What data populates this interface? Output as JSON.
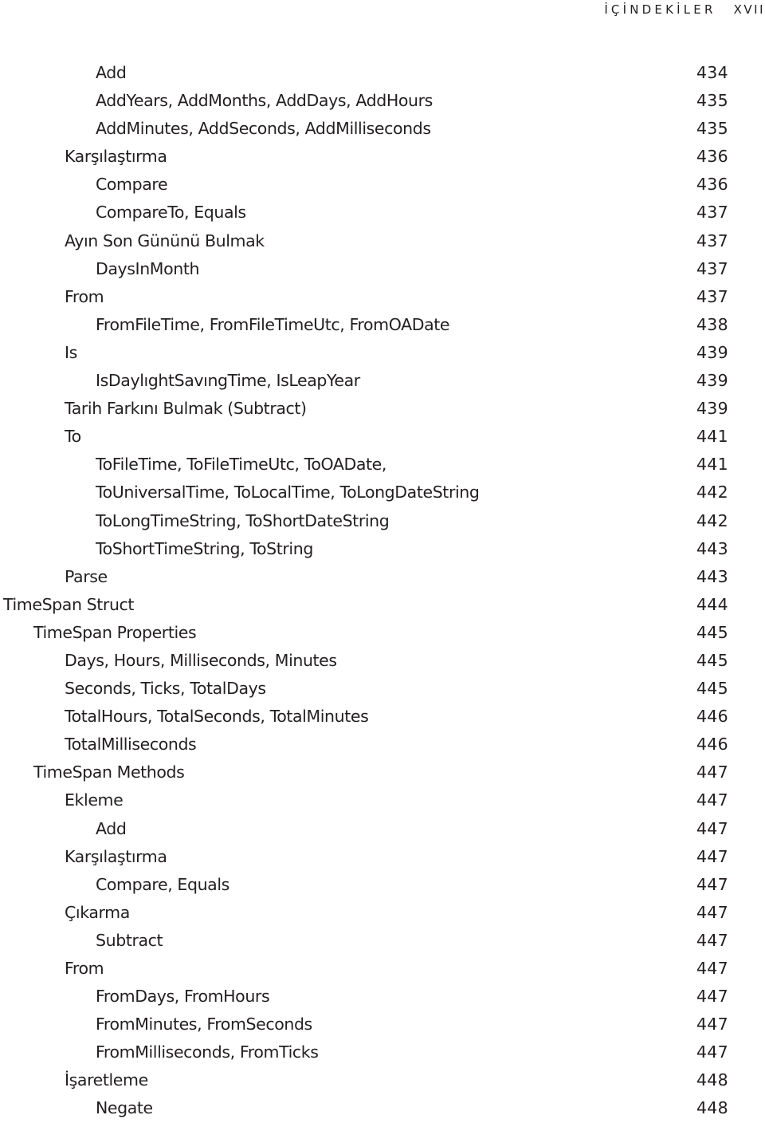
{
  "header": {
    "title": "İÇİNDEKİLER",
    "folio": "XVII"
  },
  "toc": {
    "entries": [
      {
        "title": "Add",
        "page": "434",
        "level": 3
      },
      {
        "title": "AddYears, AddMonths, AddDays, AddHours",
        "page": "435",
        "level": 3
      },
      {
        "title": "AddMinutes, AddSeconds, AddMilliseconds",
        "page": "435",
        "level": 3
      },
      {
        "title": "Karşılaştırma",
        "page": "436",
        "level": 2
      },
      {
        "title": "Compare",
        "page": "436",
        "level": 3
      },
      {
        "title": "CompareTo, Equals",
        "page": "437",
        "level": 3
      },
      {
        "title": "Ayın Son Gününü Bulmak",
        "page": "437",
        "level": 2
      },
      {
        "title": "DaysInMonth",
        "page": "437",
        "level": 3
      },
      {
        "title": "From",
        "page": "437",
        "level": 2
      },
      {
        "title": "FromFileTime, FromFileTimeUtc, FromOADate",
        "page": "438",
        "level": 3
      },
      {
        "title": "Is",
        "page": "439",
        "level": 2
      },
      {
        "title": "IsDaylıghtSavıngTime, IsLeapYear",
        "page": "439",
        "level": 3
      },
      {
        "title": "Tarih Farkını Bulmak (Subtract)",
        "page": "439",
        "level": 2
      },
      {
        "title": "To",
        "page": "441",
        "level": 2
      },
      {
        "title": "ToFileTime, ToFileTimeUtc, ToOADate,",
        "page": "441",
        "level": 3
      },
      {
        "title": "ToUniversalTime, ToLocalTime, ToLongDateString",
        "page": "442",
        "level": 3
      },
      {
        "title": "ToLongTimeString, ToShortDateString",
        "page": "442",
        "level": 3
      },
      {
        "title": "ToShortTimeString, ToString",
        "page": "443",
        "level": 3
      },
      {
        "title": "Parse",
        "page": "443",
        "level": 2
      },
      {
        "title": "TimeSpan Struct",
        "page": "444",
        "level": 0
      },
      {
        "title": "TimeSpan Properties",
        "page": "445",
        "level": 1
      },
      {
        "title": "Days, Hours, Milliseconds, Minutes",
        "page": "445",
        "level": 2
      },
      {
        "title": "Seconds, Ticks, TotalDays",
        "page": "445",
        "level": 2
      },
      {
        "title": "TotalHours, TotalSeconds, TotalMinutes",
        "page": "446",
        "level": 2
      },
      {
        "title": "TotalMilliseconds",
        "page": "446",
        "level": 2
      },
      {
        "title": "TimeSpan Methods",
        "page": "447",
        "level": 1
      },
      {
        "title": "Ekleme",
        "page": "447",
        "level": 2
      },
      {
        "title": "Add",
        "page": "447",
        "level": 3
      },
      {
        "title": "Karşılaştırma",
        "page": "447",
        "level": 2
      },
      {
        "title": "Compare, Equals",
        "page": "447",
        "level": 3
      },
      {
        "title": "Çıkarma",
        "page": "447",
        "level": 2
      },
      {
        "title": "Subtract",
        "page": "447",
        "level": 3
      },
      {
        "title": "From",
        "page": "447",
        "level": 2
      },
      {
        "title": "FromDays, FromHours",
        "page": "447",
        "level": 3
      },
      {
        "title": "FromMinutes, FromSeconds",
        "page": "447",
        "level": 3
      },
      {
        "title": "FromMilliseconds, FromTicks",
        "page": "447",
        "level": 3
      },
      {
        "title": "İşaretleme",
        "page": "448",
        "level": 2
      },
      {
        "title": "Negate",
        "page": "448",
        "level": 3
      }
    ]
  }
}
